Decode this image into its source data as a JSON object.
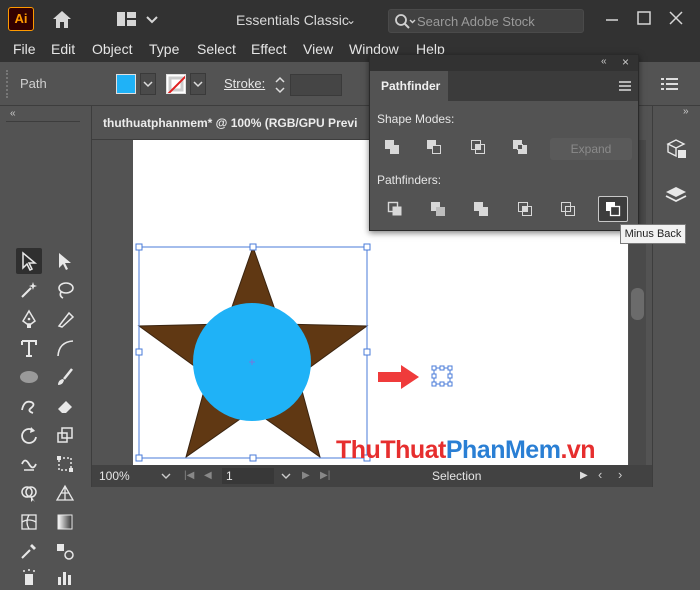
{
  "app": {
    "logo_text": "Ai"
  },
  "titlebar": {
    "workspace": "Essentials Classic",
    "search_placeholder": "Search Adobe Stock"
  },
  "menu": [
    "File",
    "Edit",
    "Object",
    "Type",
    "Select",
    "Effect",
    "View",
    "Window",
    "Help"
  ],
  "controlbar": {
    "selection_type": "Path",
    "stroke_label": "Stroke:",
    "fill_color": "#1fb2f7",
    "stroke_color": "none"
  },
  "document": {
    "tab_title": "thuthuatphanmem* @ 100% (RGB/GPU Previ"
  },
  "artwork": {
    "star_color": "#603813",
    "circle_color": "#1fb2f7",
    "arrow_color": "#ef3b3b"
  },
  "pathfinder": {
    "title": "Pathfinder",
    "shape_modes_label": "Shape Modes:",
    "pathfinders_label": "Pathfinders:",
    "expand_label": "Expand",
    "shape_mode_buttons": [
      "Unite",
      "Minus Front",
      "Intersect",
      "Exclude"
    ],
    "pathfinder_buttons": [
      "Divide",
      "Trim",
      "Merge",
      "Crop",
      "Outline",
      "Minus Back"
    ],
    "tooltip": "Minus Back"
  },
  "statusbar": {
    "zoom": "100%",
    "page": "1",
    "status": "Selection"
  },
  "watermark": {
    "part1": "ThuThuat",
    "part2": "PhanMem",
    "part3": ".vn",
    "color1": "#e62e2e",
    "color2": "#2a7fd4"
  }
}
